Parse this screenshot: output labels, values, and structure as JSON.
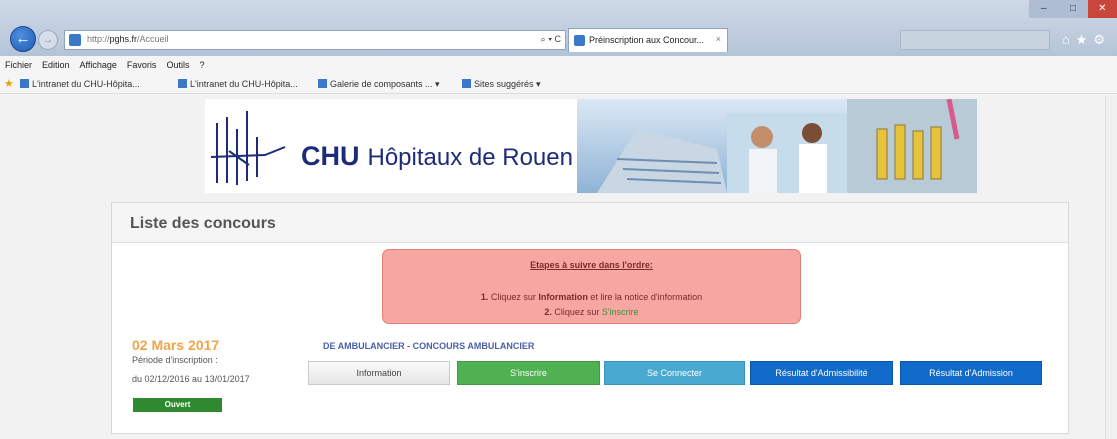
{
  "browser": {
    "url_prefix": "http://",
    "url_host": "pghs.fr",
    "url_path": "/Accueil",
    "address_tools": "⌕ ▾ C",
    "tab_title": "Préinscription aux Concour...",
    "tab_close": "×",
    "nav_back": "←",
    "nav_forward": "→",
    "right_icons": "⌂★⚙",
    "window_buttons": {
      "minimize": "–",
      "maximize": "□",
      "close": "✕"
    },
    "menu": [
      "Fichier",
      "Edition",
      "Affichage",
      "Favoris",
      "Outils",
      "?"
    ],
    "favorites": [
      "L'intranet du CHU-Hôpita...",
      "L'intranet du CHU-Hôpita...",
      "Galerie de composants ... ▾",
      "Sites suggérés ▾"
    ],
    "favorites_star": "★"
  },
  "banner": {
    "brand_short": "CHU",
    "brand_long": "Hôpitaux de Rouen"
  },
  "panel": {
    "title": "Liste des concours"
  },
  "alert": {
    "heading": "Etapes à suivre dans l'ordre:",
    "step1_num": "1.",
    "step1_pre": "Cliquez sur",
    "step1_bold": "Information",
    "step1_post": "et lire la notice d'information",
    "step2_num": "2.",
    "step2_pre": "Cliquez sur",
    "step2_link": "S'inscrire"
  },
  "concours": {
    "date": "02 Mars 2017",
    "period_label": "Période d'inscription :",
    "period_range": "du 02/12/2016 au 13/01/2017",
    "status": "Ouvert",
    "name": "DE AMBULANCIER - CONCOURS AMBULANCIER",
    "buttons": {
      "information": "Information",
      "inscrire": "S'inscrire",
      "connecter": "Se Connecter",
      "admissibilite": "Résultat d'Admissibilité",
      "admission": "Résultat d'Admission"
    }
  },
  "colors": {
    "brand_navy": "#1d2c7a",
    "alert_bg": "#f6a7a1",
    "date_orange": "#f0a44a",
    "green": "#4fb151",
    "cyan": "#4aa9d1",
    "blue": "#0f6ac9"
  }
}
